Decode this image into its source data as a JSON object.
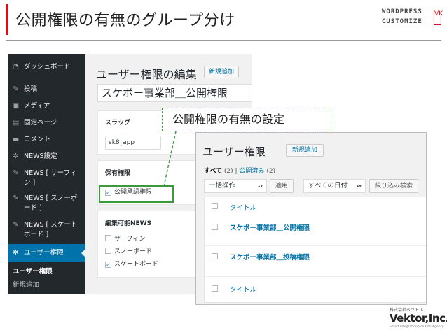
{
  "slide": {
    "title": "公開権限の有無のグループ分け",
    "brand_line1": "WORDPRESS",
    "brand_line2": "CUSTOMIZE",
    "brand_mark": "VK",
    "accent_color": "#c9151e"
  },
  "wp_sidebar": {
    "items": [
      {
        "label": "ダッシュボード",
        "icon": "dashboard-icon",
        "glyph": "◔"
      },
      {
        "label": "投稿",
        "icon": "pin-icon",
        "glyph": "✎"
      },
      {
        "label": "メディア",
        "icon": "media-icon",
        "glyph": "▣"
      },
      {
        "label": "固定ページ",
        "icon": "page-icon",
        "glyph": "▤"
      },
      {
        "label": "コメント",
        "icon": "comment-icon",
        "glyph": "▬"
      },
      {
        "label": "NEWS設定",
        "icon": "gear-icon",
        "glyph": "✲"
      },
      {
        "label": "NEWS [ サーフィ",
        "label2": "ン ]",
        "icon": "pin-icon",
        "glyph": "✎"
      },
      {
        "label": "NEWS [ スノーボ",
        "label2": "ード ]",
        "icon": "pin-icon",
        "glyph": "✎"
      },
      {
        "label": "NEWS [ スケート",
        "label2": "ボード ]",
        "icon": "pin-icon",
        "glyph": "✎"
      },
      {
        "label": "ユーザー権限",
        "icon": "gear-icon",
        "glyph": "✲"
      }
    ],
    "sub_items": [
      "ユーザー権限",
      "新規追加"
    ]
  },
  "edit": {
    "title": "ユーザー権限の編集",
    "add_new": "新規追加",
    "name_value": "スケボー事業部＿公開権限",
    "slug_heading": "スラッグ",
    "slug_value": "sk8_app",
    "caps_heading": "保有権限",
    "cap_option": "公開承認権限",
    "news_heading": "編集可能NEWS",
    "news_options": [
      {
        "label": "サーフィン",
        "checked": false
      },
      {
        "label": "スノーボード",
        "checked": false
      },
      {
        "label": "スケートボード",
        "checked": true
      }
    ],
    "check_glyph": "✓"
  },
  "callout": {
    "text": "公開権限の有無の設定"
  },
  "list": {
    "title": "ユーザー権限",
    "add_new": "新規追加",
    "views_all": "すべて",
    "views_all_count": "(2)",
    "views_sep": "|",
    "views_published": "公開済み",
    "views_published_count": "(2)",
    "bulk_select": "一括操作",
    "apply": "適用",
    "date_select": "すべての日付",
    "filter": "絞り込み検索",
    "select_arrow": "▴▾",
    "column_header": "タイトル",
    "rows": [
      "スケボー事業部＿公開権限",
      "スケボー事業部＿投稿権限"
    ],
    "column_footer": "タイトル"
  },
  "footer": {
    "company_kana": "株式会社ベクトル",
    "company": "Vektor,Inc.",
    "tagline": "Smart Integration Solution Agency"
  }
}
